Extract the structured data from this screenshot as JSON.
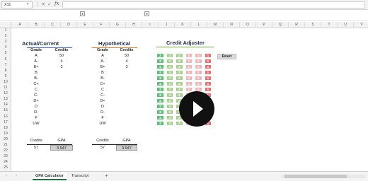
{
  "formula_bar": {
    "name_box": "X11",
    "formula": ""
  },
  "columns": [
    "A",
    "B",
    "C",
    "D",
    "E",
    "F",
    "G",
    "H",
    "I",
    "J",
    "K",
    "L",
    "M",
    "N",
    "O",
    "P",
    "Q",
    "R",
    "S",
    "T",
    "U",
    "V"
  ],
  "rows": [
    "1",
    "2",
    "3",
    "4",
    "5",
    "6",
    "7",
    "8",
    "9",
    "10",
    "11",
    "12",
    "13",
    "14",
    "15",
    "16",
    "17",
    "18",
    "19",
    "20",
    "21",
    "22",
    "23",
    "24",
    "25"
  ],
  "actual": {
    "title": "Actual/Current",
    "grade_header": "Grade",
    "credits_header": "Credits",
    "grades": [
      "A",
      "A-",
      "B+",
      "B",
      "B-",
      "C+",
      "C",
      "C-",
      "D+",
      "D",
      "D-",
      "F",
      "UW"
    ],
    "credits": [
      "50",
      "4",
      "3",
      "",
      "",
      "",
      "",
      "",
      "",
      "",
      "",
      "",
      ""
    ],
    "summary_credits_label": "Credits",
    "summary_gpa_label": "GPA",
    "summary_credits": "57",
    "summary_gpa": "3.947"
  },
  "hypothetical": {
    "title": "Hypothetical",
    "grade_header": "Grade",
    "credits_header": "Credits",
    "grades": [
      "A",
      "A-",
      "B+",
      "B",
      "B-",
      "C+",
      "C",
      "C-",
      "D+",
      "D",
      "D-",
      "F",
      "UW"
    ],
    "credits": [
      "50",
      "4",
      "3",
      "",
      "",
      "",
      "",
      "",
      "",
      "",
      "",
      "",
      ""
    ],
    "summary_credits_label": "Credits",
    "summary_gpa_label": "GPA",
    "summary_credits": "57",
    "summary_gpa": "3.947"
  },
  "adjuster": {
    "title": "Credit Adjuster",
    "reset_label": "Reset",
    "values": [
      [
        "3",
        "3",
        "2",
        "1",
        "1",
        "1"
      ],
      [
        "3",
        "3",
        "2",
        "1",
        "1",
        "1"
      ],
      [
        "3",
        "3",
        "2",
        "1",
        "1",
        "1"
      ],
      [
        "3",
        "3",
        "2",
        "1",
        "1",
        "1"
      ],
      [
        "3",
        "3",
        "2",
        "1",
        "1",
        "1"
      ],
      [
        "3",
        "3",
        "2",
        "1",
        "1",
        "1"
      ],
      [
        "3",
        "3",
        "2",
        "1",
        "1",
        "1"
      ],
      [
        "3",
        "3",
        "2",
        "1",
        "1",
        "1"
      ],
      [
        "3",
        "3",
        "2",
        "1",
        "1",
        "1"
      ],
      [
        "3",
        "3",
        "2",
        "1",
        "1",
        "1"
      ],
      [
        "3",
        "3",
        "2",
        "1",
        "1",
        "1"
      ],
      [
        "3",
        "3",
        "2",
        "1",
        "1",
        "1"
      ],
      [
        "3",
        "3",
        "2",
        "1",
        "1",
        "1"
      ]
    ]
  },
  "tabs": {
    "active": "GPA Calculator",
    "other": "Transcript",
    "add": "+"
  },
  "colors": {
    "actual_underline": "#4472c4",
    "hypothetical_underline": "#ed7d31",
    "adjuster_underline": "#70ad47",
    "green_dark": "#63be7b",
    "green_light": "#a9d18e",
    "red_light": "#f4b6b6",
    "red_dark": "#e57373",
    "gpa_fill": "#d0d0d0"
  }
}
